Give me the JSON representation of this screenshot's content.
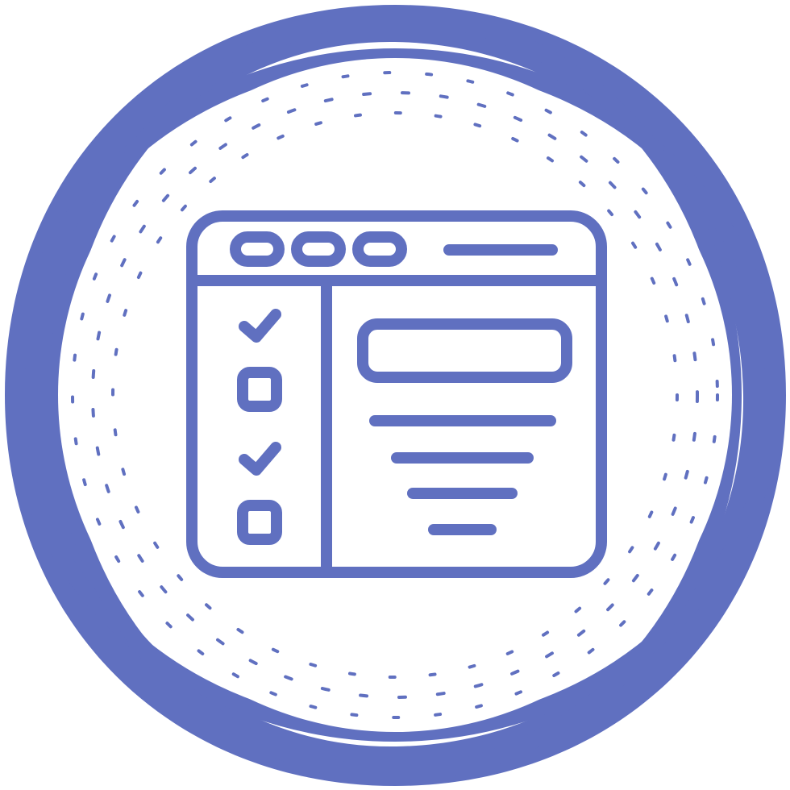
{
  "colors": {
    "accent": "#6070c0",
    "background": "#ffffff"
  },
  "icon": {
    "name": "browser-checklist-icon",
    "checklist": [
      {
        "state": "checked",
        "icon": "checkmark-icon"
      },
      {
        "state": "unchecked",
        "icon": "checkbox-icon"
      },
      {
        "state": "checked",
        "icon": "checkmark-icon"
      },
      {
        "state": "unchecked",
        "icon": "checkbox-icon"
      }
    ]
  }
}
